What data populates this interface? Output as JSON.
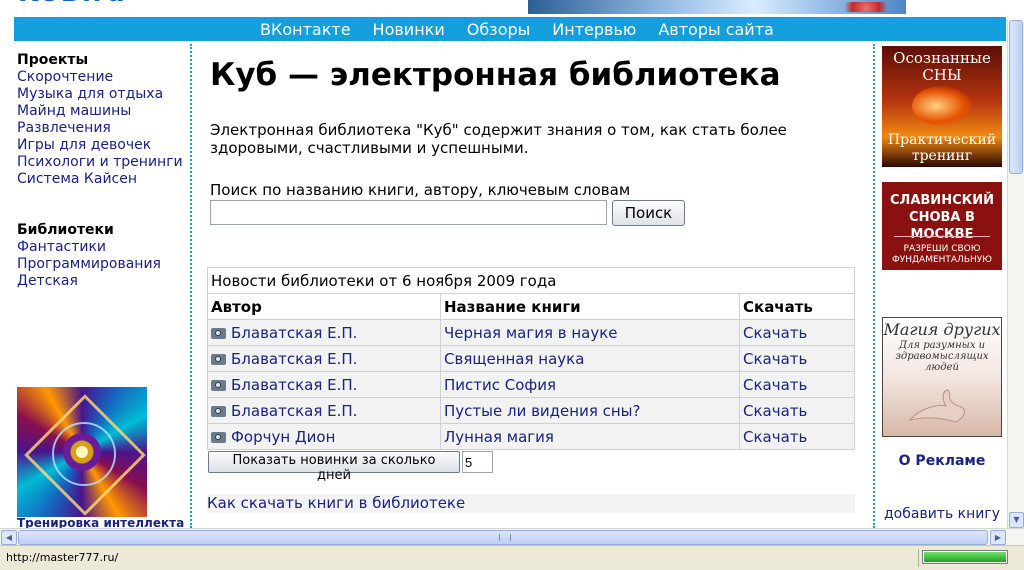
{
  "logo": {
    "text": "KUB.ru"
  },
  "nav": [
    "ВКонтакте",
    "Новинки",
    "Обзоры",
    "Интервью",
    "Авторы сайта"
  ],
  "left": {
    "projects_title": "Проекты",
    "projects": [
      "Скорочтение",
      "Музыка для отдыха",
      "Майнд машины",
      "Развлечения",
      "Игры для девочек",
      "Психологи и тренинги",
      "Система Кайсен"
    ],
    "libraries_title": "Библиотеки",
    "libraries": [
      "Фантастики",
      "Программирования",
      "Детская"
    ],
    "image_caption": "Тренировка интеллекта"
  },
  "main": {
    "title": "Куб — электронная библиотека",
    "intro": "Электронная библиотека \"Куб\" содержит знания о том, как стать более здоровыми, счастливыми и успешными.",
    "search_label": "Поиск по названию книги, автору, ключевым словам",
    "search_value": "",
    "search_button": "Поиск",
    "news_caption": "Новости библиотеки от 6 ноября 2009 года",
    "news_headers": [
      "Автор",
      "Название книги",
      "Скачать"
    ],
    "news_rows": [
      {
        "author": "Блаватская Е.П.",
        "title": "Черная магия в науке",
        "download": "Скачать"
      },
      {
        "author": "Блаватская Е.П.",
        "title": "Священная наука",
        "download": "Скачать"
      },
      {
        "author": "Блаватская Е.П.",
        "title": "Пистис София",
        "download": "Скачать"
      },
      {
        "author": "Блаватская Е.П.",
        "title": "Пустые ли видения сны?",
        "download": "Скачать"
      },
      {
        "author": "Форчун Дион",
        "title": "Лунная магия",
        "download": "Скачать"
      }
    ],
    "days_button": "Показать новинки за сколько дней",
    "days_value": "5",
    "howto_link": "Как скачать книги в библиотеке"
  },
  "right": {
    "ad1_top": "Осознанные СНЫ",
    "ad1_bottom": "Практический тренинг",
    "ad2_title": "СЛАВИНСКИЙ СНОВА В МОСКВЕ",
    "ad2_sub": "РАЗРЕШИ СВОЮ ФУНДАМЕНТАЛЬНУЮ",
    "ad3_title": "Магия других",
    "ad3_sub": "Для разумных и здравомыслящих людей",
    "about_ads": "О Рекламе",
    "add_book": "добавить книгу"
  },
  "status": {
    "url": "http://master777.ru/",
    "progress": 1.0
  },
  "colors": {
    "nav_bg": "#139fdb",
    "link": "#1a237e",
    "separator": "#1aa0cc"
  }
}
